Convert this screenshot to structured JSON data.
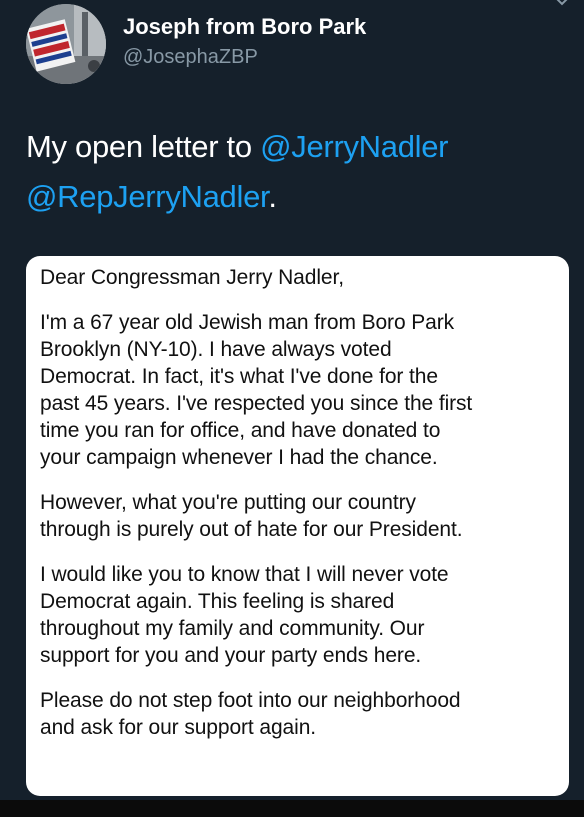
{
  "author": {
    "display_name": "Joseph from Boro Park",
    "handle": "@JosephaZBP"
  },
  "tweet": {
    "text_before": "My open letter to ",
    "mention1": "@JerryNadler",
    "text_between": " ",
    "mention2": "@RepJerryNadler",
    "text_after": "."
  },
  "letter": {
    "paragraphs": [
      "Dear Congressman Jerry Nadler,",
      "I'm a 67 year old Jewish man from Boro Park\nBrooklyn (NY-10). I have always voted\nDemocrat. In fact, it's what I've done for the\npast 45 years. I've respected you since the first\ntime you ran for office, and have donated to\nyour campaign whenever I had the chance.",
      "However, what you're putting our country\nthrough is purely out of hate for our President.",
      "I would like you to know that I will never vote\nDemocrat again. This feeling is shared\nthroughout my family and community. Our\nsupport for you and your party ends here.",
      "Please do not step foot into our neighborhood\nand ask for our support again."
    ]
  },
  "icons": {
    "more": "chevron-down-icon"
  },
  "colors": {
    "background": "#15202b",
    "link": "#1da1f2",
    "secondary_text": "#8899a6"
  }
}
